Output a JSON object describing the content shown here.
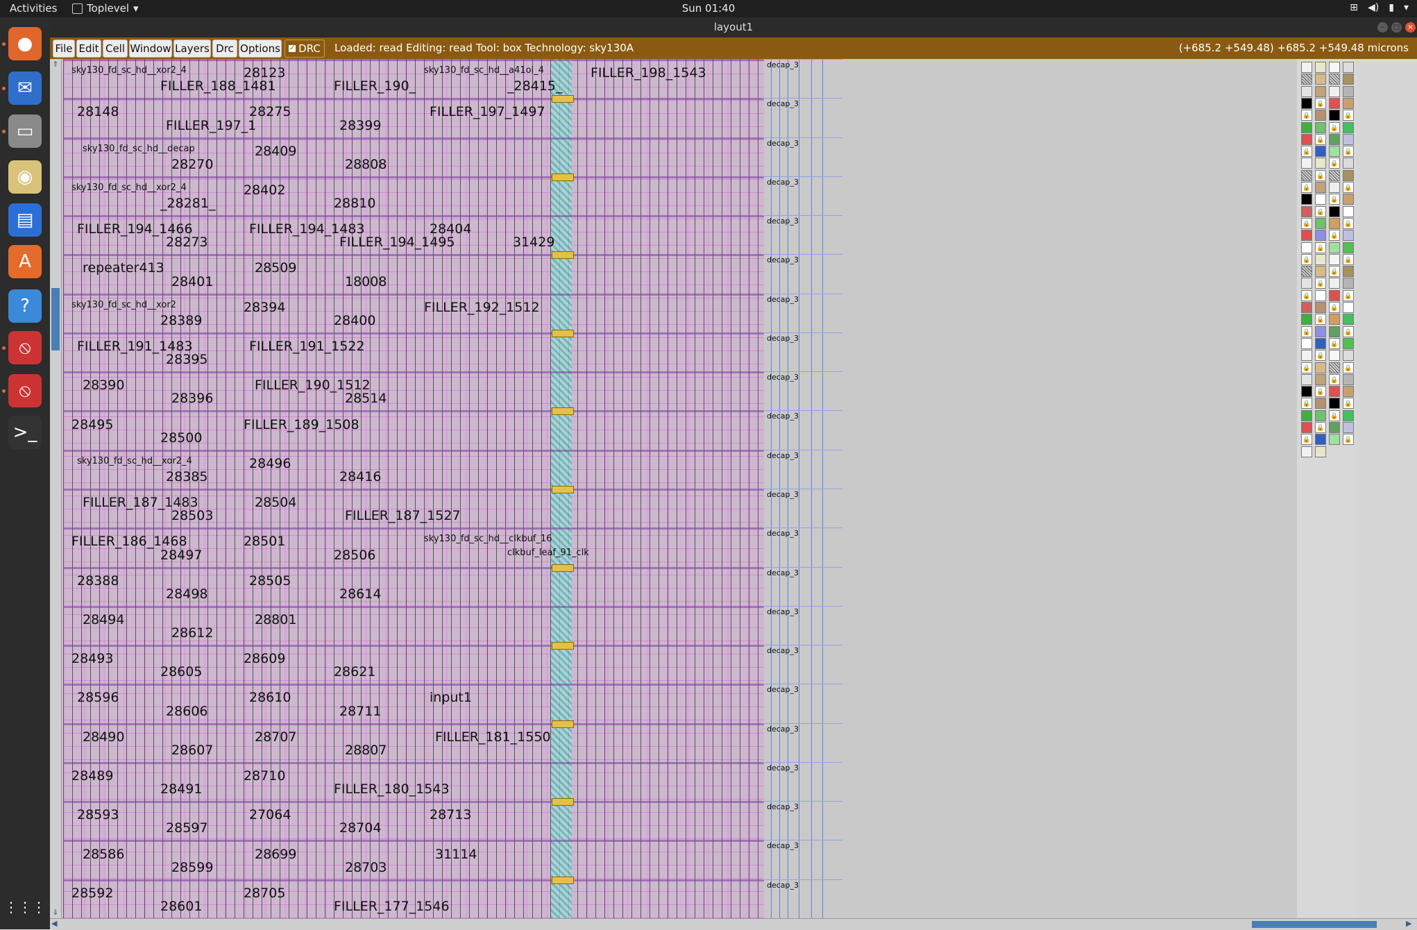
{
  "topbar": {
    "activities": "Activities",
    "app_name": "Toplevel",
    "clock": "Sun 01:40"
  },
  "dock": {
    "items": [
      {
        "name": "firefox-icon",
        "glyph": "●",
        "color": "#e0662a"
      },
      {
        "name": "thunderbird-icon",
        "glyph": "✉",
        "color": "#2f6fc9"
      },
      {
        "name": "files-icon",
        "glyph": "▭",
        "color": "#8a8a8a"
      },
      {
        "name": "rhythmbox-icon",
        "glyph": "◉",
        "color": "#d9c27a"
      },
      {
        "name": "writer-icon",
        "glyph": "▤",
        "color": "#2b6fd6"
      },
      {
        "name": "software-icon",
        "glyph": "A",
        "color": "#e46b2a"
      },
      {
        "name": "help-icon",
        "glyph": "?",
        "color": "#3b8ad9"
      },
      {
        "name": "magic-icon-1",
        "glyph": "⦸",
        "color": "#c33"
      },
      {
        "name": "magic-icon-2",
        "glyph": "⦸",
        "color": "#c33"
      },
      {
        "name": "terminal-icon",
        "glyph": ">_",
        "color": "#333"
      }
    ],
    "apps_grid": "⋮⋮⋮"
  },
  "window": {
    "title": "layout1"
  },
  "menubar": {
    "file": "File",
    "edit": "Edit",
    "cell": "Cell",
    "window": "Window",
    "layers": "Layers",
    "drc": "Drc",
    "options": "Options",
    "drc_toggle": "DRC",
    "status": "Loaded: read Editing: read Tool: box  Technology: sky130A",
    "coords": "(+685.2 +549.48) +685.2 +549.48 microns"
  },
  "layout": {
    "rows": [
      {
        "labels": [
          "sky130_fd_sc_hd__xor2_4",
          "FILLER_188_1481",
          "28123",
          "FILLER_190_",
          "sky130_fd_sc_hd__a41oi_4",
          "_28415_",
          "FILLER_198_1543"
        ]
      },
      {
        "labels": [
          "28148",
          "FILLER_197_1",
          "28275",
          "28399",
          "FILLER_197_1497"
        ]
      },
      {
        "labels": [
          "sky130_fd_sc_hd__decap",
          "28270",
          "28409",
          "28808"
        ]
      },
      {
        "labels": [
          "sky130_fd_sc_hd__xor2_4",
          "_28281_",
          "28402",
          "28810"
        ]
      },
      {
        "labels": [
          "FILLER_194_1466",
          "28273",
          "FILLER_194_1483",
          "FILLER_194_1495",
          "28404",
          "31429"
        ]
      },
      {
        "labels": [
          "repeater413",
          "28401",
          "28509",
          "18008"
        ]
      },
      {
        "labels": [
          "sky130_fd_sc_hd__xor2",
          "28389",
          "28394",
          "28400",
          "FILLER_192_1512"
        ]
      },
      {
        "labels": [
          "FILLER_191_1483",
          "28395",
          "FILLER_191_1522"
        ]
      },
      {
        "labels": [
          "28390",
          "28396",
          "FILLER_190_1512",
          "28514"
        ]
      },
      {
        "labels": [
          "28495",
          "28500",
          "FILLER_189_1508"
        ]
      },
      {
        "labels": [
          "sky130_fd_sc_hd__xor2_4",
          "28385",
          "28496",
          "28416"
        ]
      },
      {
        "labels": [
          "FILLER_187_1483",
          "28503",
          "28504",
          "FILLER_187_1527"
        ]
      },
      {
        "labels": [
          "FILLER_186_1468",
          "28497",
          "28501",
          "28506",
          "sky130_fd_sc_hd__clkbuf_16",
          "clkbuf_leaf_91_clk"
        ]
      },
      {
        "labels": [
          "28388",
          "28498",
          "28505",
          "28614"
        ]
      },
      {
        "labels": [
          "28494",
          "28612",
          "28801"
        ]
      },
      {
        "labels": [
          "28493",
          "28605",
          "28609",
          "28621"
        ]
      },
      {
        "labels": [
          "28596",
          "28606",
          "28610",
          "28711",
          "input1"
        ]
      },
      {
        "labels": [
          "28490",
          "28607",
          "28707",
          "28807",
          "FILLER_181_1550"
        ]
      },
      {
        "labels": [
          "28489",
          "28491",
          "28710",
          "FILLER_180_1543"
        ]
      },
      {
        "labels": [
          "28593",
          "28597",
          "27064",
          "28704",
          "28713"
        ]
      },
      {
        "labels": [
          "28586",
          "28599",
          "28699",
          "28703",
          "31114"
        ]
      },
      {
        "labels": [
          "28592",
          "28601",
          "28705",
          "FILLER_177_1546"
        ]
      }
    ],
    "decap_label": "decap_3"
  }
}
